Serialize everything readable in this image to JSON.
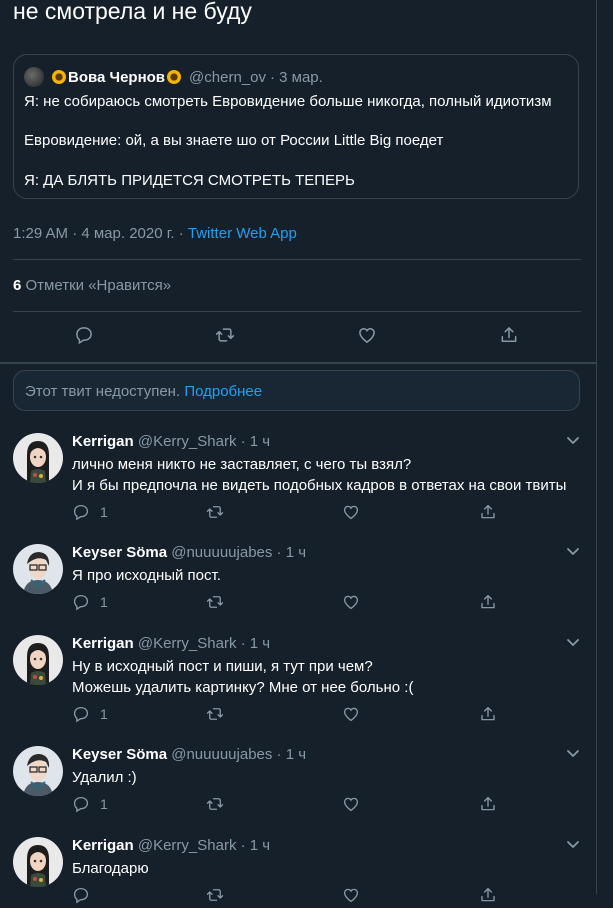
{
  "main_tweet": {
    "text": "не смотрела и не буду",
    "quoted": {
      "name": "Вова Чернов",
      "handle": "@chern_ov",
      "time": "· 3 мар.",
      "line1": "Я: не собираюсь смотреть Евровидение больше никогда, полный идиотизм",
      "line2": "Евровидение: ой, а вы знаете шо от России Little Big поедет",
      "line3": "Я: ДА БЛЯТЬ ПРИДЕТСЯ СМОТРЕТЬ ТЕПЕРЬ"
    },
    "timestamp": "1:29 AM · 4 мар. 2020 г. · ",
    "source": "Twitter Web App",
    "likes_count": "6",
    "likes_label": "Отметки «Нравится»"
  },
  "unavailable": {
    "text": "Этот твит недоступен. ",
    "link": "Подробнее"
  },
  "replies": [
    {
      "name": "Kerrigan",
      "handle": "@Kerry_Shark",
      "time": "· 1 ч",
      "lines": [
        "лично меня никто не заставляет, с чего ты взял?",
        "И я бы предпочла не видеть подобных кадров в ответах на свои твиты"
      ],
      "reply_count": "1"
    },
    {
      "name": "Keyser Söma",
      "handle": "@nuuuuujabes",
      "time": "· 1 ч",
      "lines": [
        "Я про исходный пост."
      ],
      "reply_count": "1"
    },
    {
      "name": "Kerrigan",
      "handle": "@Kerry_Shark",
      "time": "· 1 ч",
      "lines": [
        "Ну в исходный пост и пиши, я тут при чем?",
        "Можешь удалить картинку? Мне от нее больно :("
      ],
      "reply_count": "1"
    },
    {
      "name": "Keyser Söma",
      "handle": "@nuuuuujabes",
      "time": "· 1 ч",
      "lines": [
        "Удалил :)"
      ],
      "reply_count": "1"
    },
    {
      "name": "Kerrigan",
      "handle": "@Kerry_Shark",
      "time": "· 1 ч",
      "lines": [
        "Благодарю"
      ],
      "reply_count": ""
    }
  ],
  "colors": {
    "background": "#15202b",
    "border": "#38444d",
    "muted": "#8899a6",
    "accent": "#1da1f2"
  },
  "icons": [
    "reply-icon",
    "retweet-icon",
    "like-icon",
    "share-icon",
    "chevron-down-icon"
  ]
}
